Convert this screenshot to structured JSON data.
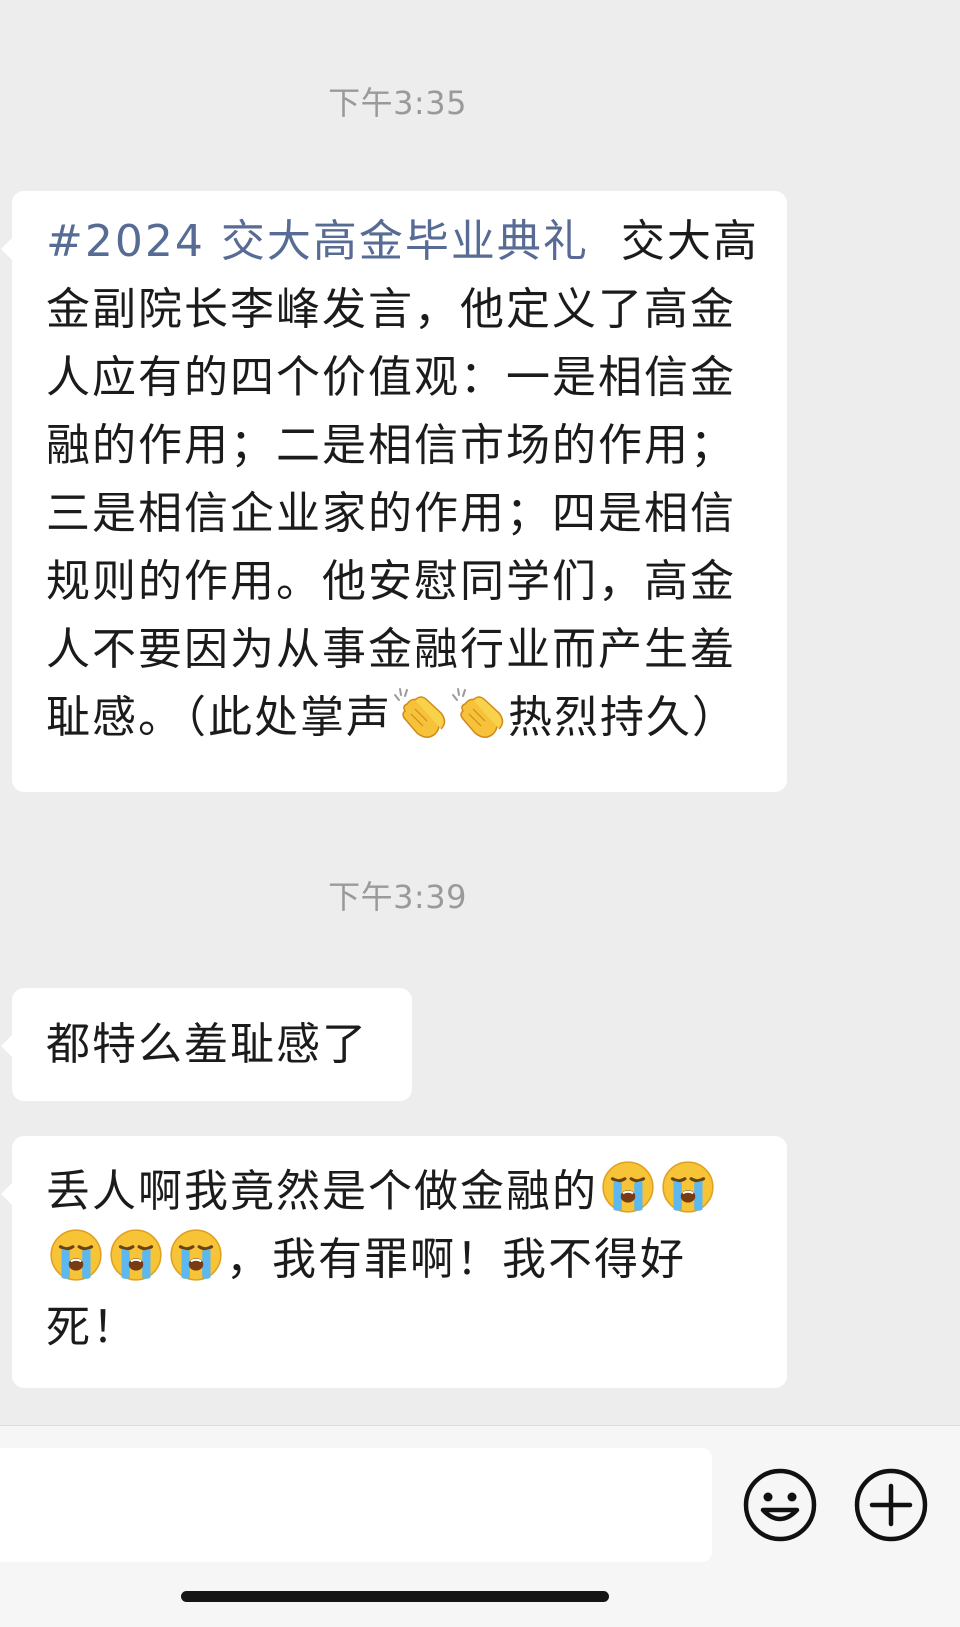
{
  "conversation": {
    "timestamps": [
      "下午3:35",
      "下午3:39"
    ],
    "messages": [
      {
        "hashtag": "#2024 交大高金毕业典礼",
        "lines": [
          "交大高",
          "金副院长李峰发言，他定义了高金",
          "人应有的四个价值观：一是相信金",
          "融的作用；二是相信市场的作用；",
          "三是相信企业家的作用；四是相信",
          "规则的作用。他安慰同学们，高金",
          "人不要因为从事金融行业而产生羞",
          "耻感。（此处掌声",
          "热烈持久）"
        ],
        "emojis": [
          "clapping-hands",
          "clapping-hands"
        ]
      },
      {
        "text": "都特么羞耻感了"
      },
      {
        "lines": [
          "丢人啊我竟然是个做金融的",
          "，我有罪啊！我不得好",
          "死！"
        ],
        "emojis": [
          "loudly-crying-face",
          "loudly-crying-face",
          "loudly-crying-face",
          "loudly-crying-face",
          "loudly-crying-face"
        ]
      }
    ]
  },
  "input_bar": {
    "value": "",
    "buttons": [
      "emoji-icon",
      "plus-icon"
    ]
  },
  "colors": {
    "background": "#ededed",
    "bubble": "#ffffff",
    "hashtag": "#576b95",
    "timestamp": "#9a9a9a"
  }
}
